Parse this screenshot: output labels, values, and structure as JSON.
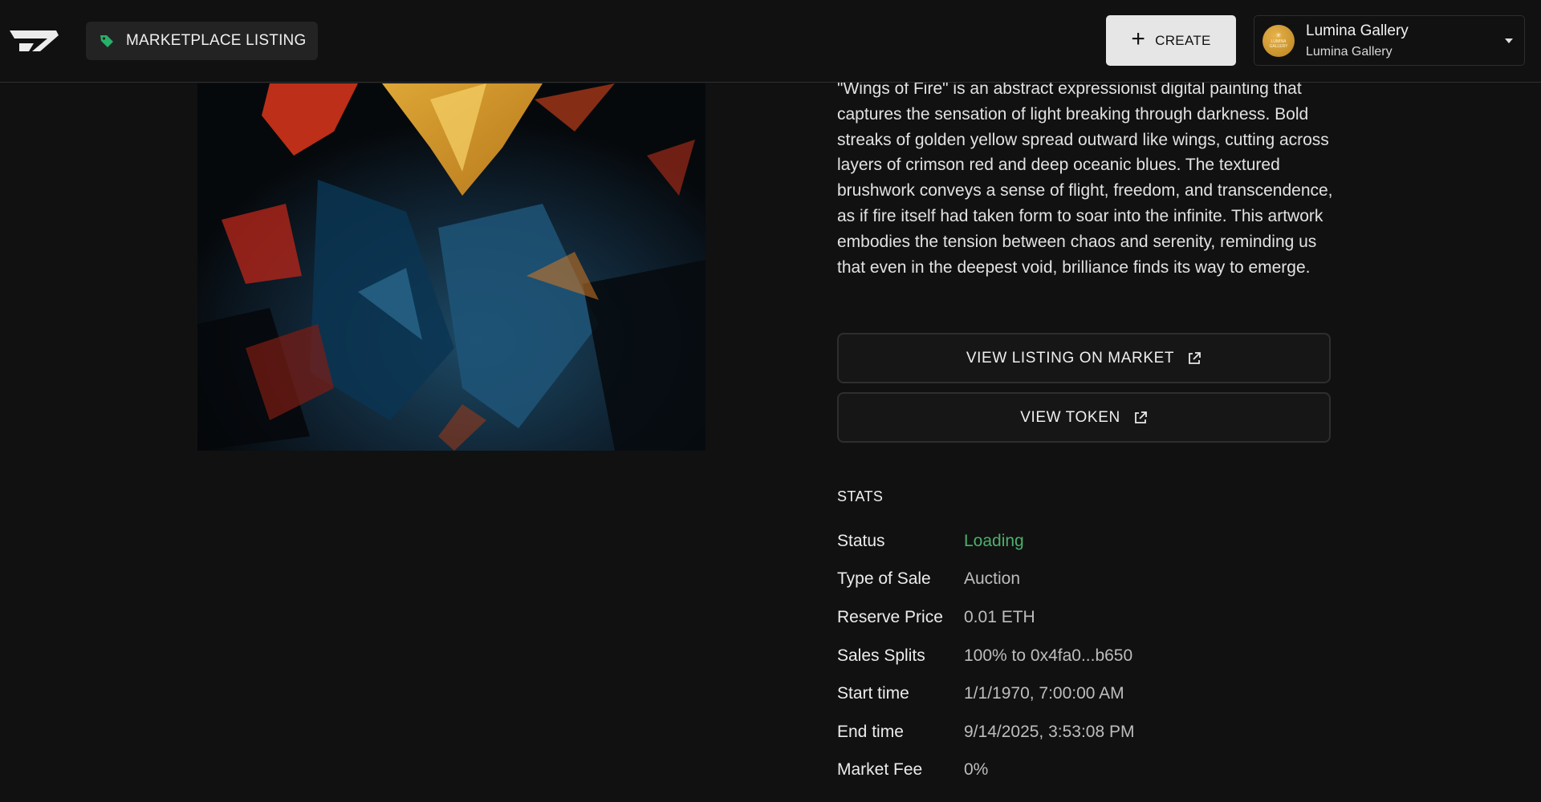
{
  "header": {
    "badge_label": "MARKETPLACE LISTING",
    "create_label": "CREATE",
    "account": {
      "name": "Lumina Gallery",
      "sub": "Lumina Gallery",
      "avatar_text": "LUMINA GALLERY"
    }
  },
  "listing": {
    "description": "\"Wings of Fire\" is an abstract expressionist digital painting that captures the sensation of light breaking through darkness. Bold streaks of golden yellow spread outward like wings, cutting across layers of crimson red and deep oceanic blues. The textured brushwork conveys a sense of flight, freedom, and transcendence, as if fire itself had taken form to soar into the infinite. This artwork embodies the tension between chaos and serenity, reminding us that even in the deepest void, brilliance finds its way to emerge.",
    "view_listing_label": "VIEW LISTING ON MARKET",
    "view_token_label": "VIEW TOKEN"
  },
  "stats": {
    "title": "STATS",
    "rows": [
      {
        "label": "Status",
        "value": "Loading"
      },
      {
        "label": "Type of Sale",
        "value": "Auction"
      },
      {
        "label": "Reserve Price",
        "value": "0.01 ETH"
      },
      {
        "label": "Sales Splits",
        "value": "100% to 0x4fa0...b650"
      },
      {
        "label": "Start time",
        "value": "1/1/1970, 7:00:00 AM"
      },
      {
        "label": "End time",
        "value": "9/14/2025, 3:53:08 PM"
      },
      {
        "label": "Market Fee",
        "value": "0%"
      }
    ]
  },
  "colors": {
    "background": "#111111",
    "accent_green": "#4caf6e",
    "create_button_bg": "#e6e6e6"
  },
  "icons": {
    "logo": "brand-logo-icon",
    "badge": "tag-icon",
    "create": "plus-icon",
    "account_caret": "chevron-down-icon",
    "external": "external-link-icon"
  }
}
